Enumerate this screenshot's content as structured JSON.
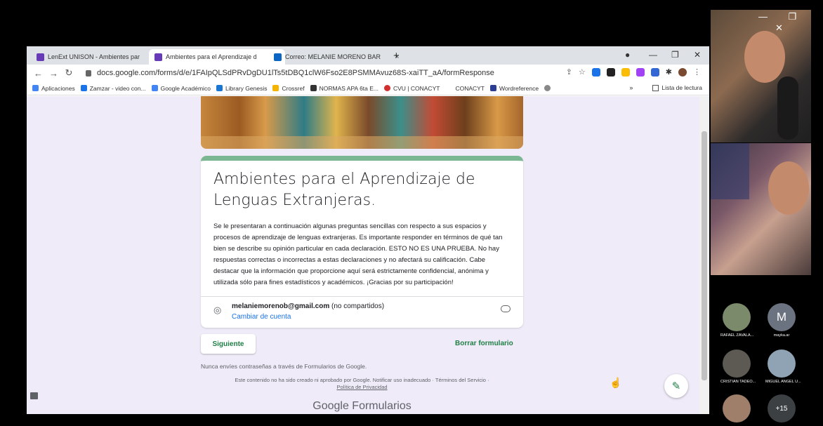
{
  "browser": {
    "tabs": [
      {
        "label": "LenExt UNISON - Ambientes par",
        "color": "#673ab7"
      },
      {
        "label": "Ambientes para el Aprendizaje d",
        "color": "#673ab7"
      },
      {
        "label": "Correo: MELANIE MORENO BAR",
        "color": "#0a66c2"
      }
    ],
    "url": "docs.google.com/forms/d/e/1FAIpQLSdPRvDgDU1lTs5tDBQ1clW6Fso2E8PSMMAvuz68S-xaiTT_aA/formResponse",
    "bookmarks": [
      {
        "label": "Aplicaciones",
        "color": "#4285f4"
      },
      {
        "label": "Zamzar - video con...",
        "color": "#1a73e8"
      },
      {
        "label": "Google Académico",
        "color": "#4285f4"
      },
      {
        "label": "Library Genesis",
        "color": "#1976d2"
      },
      {
        "label": "Crossref",
        "color": "#f4b400"
      },
      {
        "label": "NORMAS APA 6ta E...",
        "color": "#333333"
      },
      {
        "label": "CVU | CONACYT",
        "color": "#d32f2f"
      },
      {
        "label": "CONACYT",
        "color": "#999999"
      },
      {
        "label": "Wordreference",
        "color": "#2c3e94"
      }
    ],
    "reading_list": "Lista de lectura"
  },
  "form": {
    "title": "Ambientes para el Aprendizaje de Lenguas Extranjeras.",
    "description": "Se le presentaran a continuación algunas preguntas sencillas con respecto a sus espacios y procesos de aprendizaje de lenguas extranjeras. Es importante responder en términos de qué tan bien se describe su opinión particular en cada declaración. ESTO NO ES UNA PRUEBA. No hay respuestas correctas o incorrectas a estas declaraciones y no afectará su calificación. Cabe destacar que la información que proporcione aquí será estrictamente confidencial, anónima y utilizada sólo para fines estadísticos y académicos. ¡Gracias por su participación!",
    "account_email": "melaniemorenob@gmail.com",
    "account_note": "(no compartidos)",
    "switch_account": "Cambiar de cuenta",
    "next_label": "Siguiente",
    "clear_label": "Borrar formulario",
    "password_note": "Nunca envíes contraseñas a través de Formularios de Google.",
    "disclaimer": "Este contenido no ha sido creado ni aprobado por Google. Notificar uso inadecuado · Términos del Servicio ·",
    "privacy": "Política de Privacidad",
    "footer_logo": "Google Formularios"
  },
  "meet": {
    "participants": [
      {
        "name": "RAFAEL ZAVALA...",
        "initial": "",
        "color": "#7a8a6a"
      },
      {
        "name": "mayka.ar",
        "initial": "M",
        "color": "#6b7280"
      },
      {
        "name": "CRISTIAN TADEO...",
        "initial": "",
        "color": "#5c5a52"
      },
      {
        "name": "MIGUEL ANGEL U...",
        "initial": "",
        "color": "#8fa3b5"
      },
      {
        "name": "",
        "initial": "",
        "color": "#a07f6a"
      },
      {
        "name": "",
        "initial": "+15",
        "color": "#3c4043"
      }
    ]
  }
}
